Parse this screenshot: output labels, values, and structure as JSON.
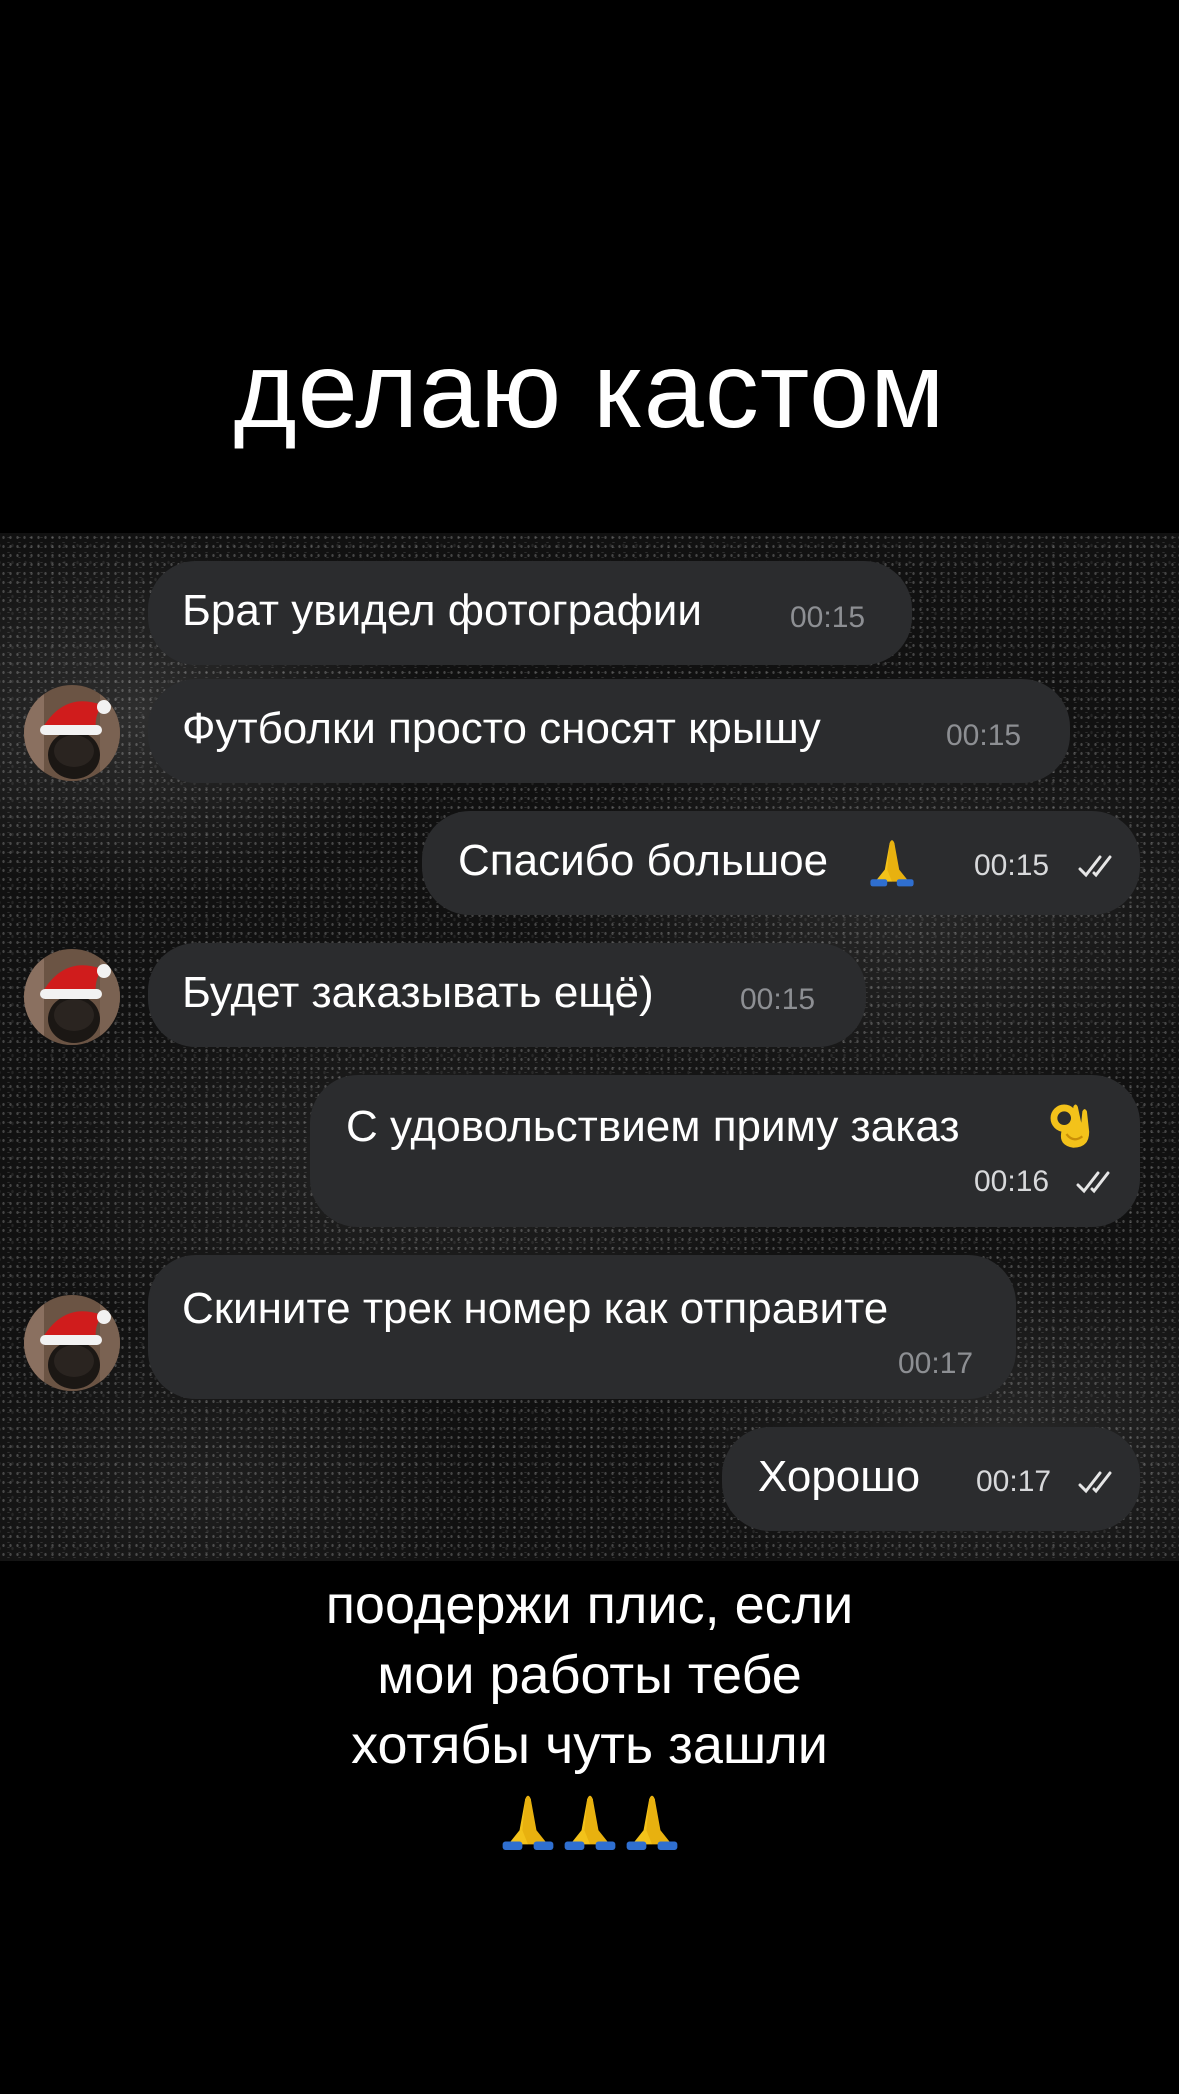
{
  "headline": "делаю кастом",
  "messages": [
    {
      "text": "Брат увидел фотографии",
      "time": "00:15",
      "direction": "incoming"
    },
    {
      "text": "Футболки просто сносят крышу",
      "time": "00:15",
      "direction": "incoming"
    },
    {
      "text": "Спасибо большое",
      "emoji": "folded-hands",
      "time": "00:15",
      "direction": "outgoing",
      "read": true
    },
    {
      "text": "Будет заказывать ещё)",
      "time": "00:15",
      "direction": "incoming"
    },
    {
      "text": "С удовольствием приму заказ",
      "emoji": "ok-hand",
      "time": "00:16",
      "direction": "outgoing",
      "read": true
    },
    {
      "text": "Скините трек номер как отправите",
      "time": "00:17",
      "direction": "incoming"
    },
    {
      "text": "Хорошо",
      "time": "00:17",
      "direction": "outgoing",
      "read": true
    }
  ],
  "footer": {
    "line1": "поодержи плис, если",
    "line2": "мои работы тебе",
    "line3": "хотябы чуть зашли",
    "emoji": [
      "folded-hands",
      "folded-hands",
      "folded-hands"
    ]
  },
  "colors": {
    "page_background": "#000000",
    "bubble": "#2b2c2e",
    "incoming_time": "#8d8f93",
    "outgoing_time": "#d8d9db"
  },
  "icons": {
    "read_receipt": "double-check-icon",
    "avatar": "santa-hat-avatar"
  }
}
